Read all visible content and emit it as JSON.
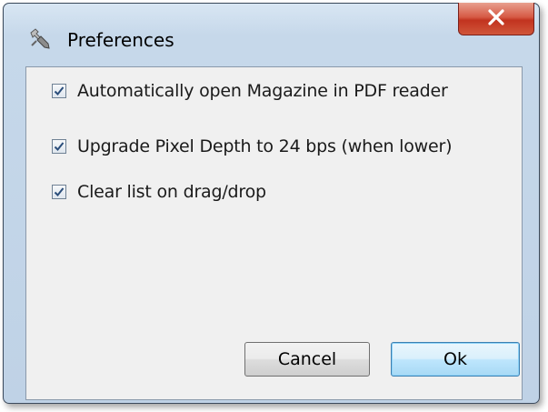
{
  "window": {
    "title": "Preferences",
    "icon": "wrench-screwdriver-icon"
  },
  "options": [
    {
      "label": "Automatically open Magazine in PDF reader",
      "checked": true
    },
    {
      "label": "Upgrade Pixel Depth to 24 bps (when lower)",
      "checked": true
    },
    {
      "label": "Clear list on drag/drop",
      "checked": true
    }
  ],
  "buttons": {
    "cancel_label": "Cancel",
    "ok_label": "Ok"
  },
  "colors": {
    "close_button": "#c2331f",
    "ok_button_border": "#3c7fb1",
    "checkmark": "#2a4d7a"
  }
}
